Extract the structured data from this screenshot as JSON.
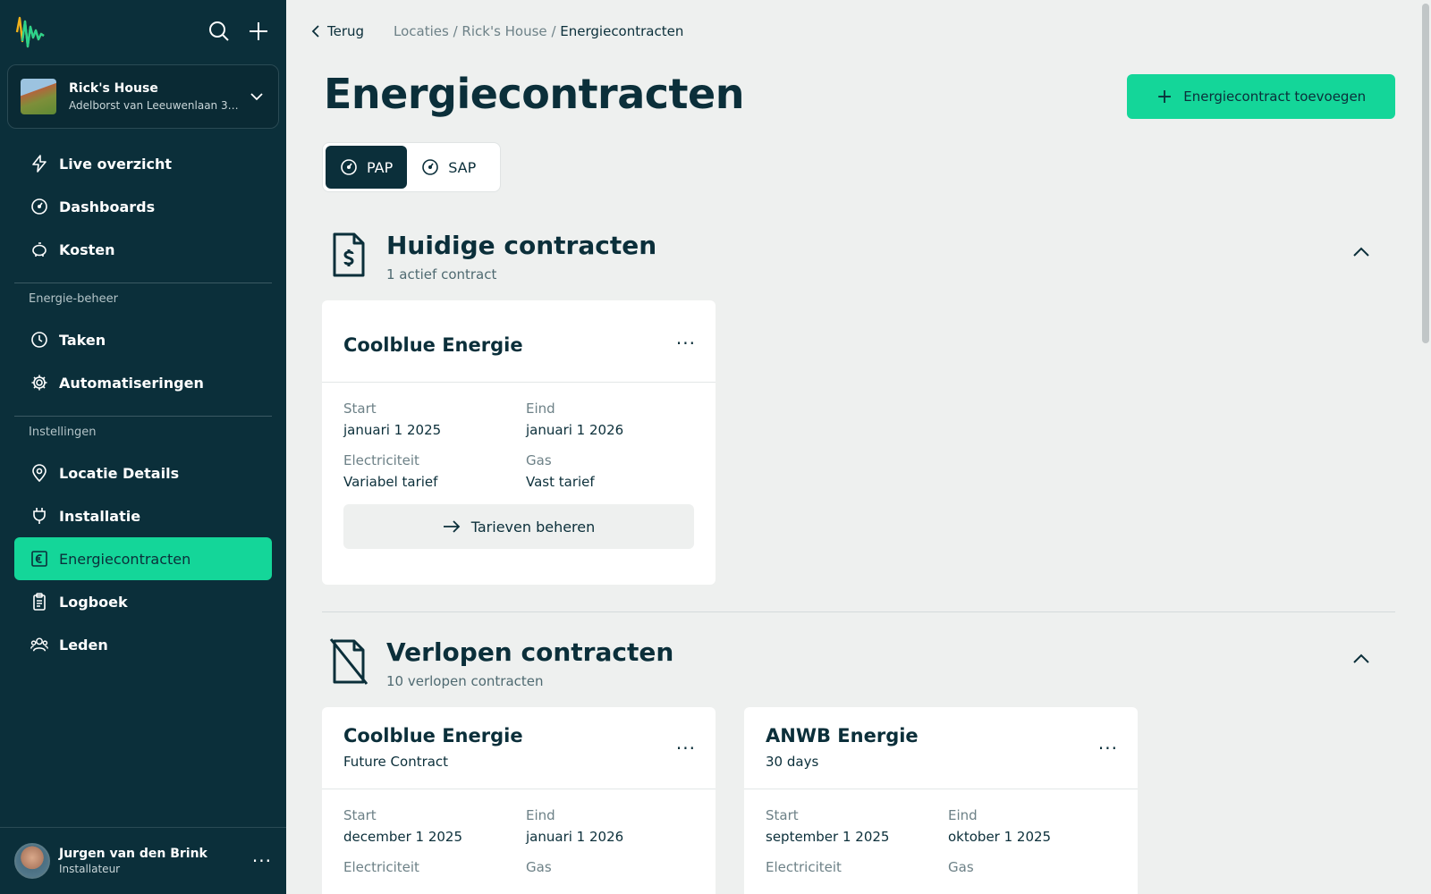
{
  "sidebar": {
    "location": {
      "name": "Rick's House",
      "address": "Adelborst van Leeuwenlaan 31,..."
    },
    "nav_main": [
      {
        "label": "Live overzicht",
        "icon": "bolt-icon"
      },
      {
        "label": "Dashboards",
        "icon": "gauge-icon"
      },
      {
        "label": "Kosten",
        "icon": "piggy-bank-icon"
      }
    ],
    "section_energy": "Energie-beheer",
    "nav_energy": [
      {
        "label": "Taken",
        "icon": "clock-icon"
      },
      {
        "label": "Automatiseringen",
        "icon": "gear-icon"
      }
    ],
    "section_settings": "Instellingen",
    "nav_settings": [
      {
        "label": "Locatie Details",
        "icon": "map-pin-icon"
      },
      {
        "label": "Installatie",
        "icon": "plug-icon"
      },
      {
        "label": "Energiecontracten",
        "icon": "euro-note-icon",
        "active": true
      },
      {
        "label": "Logboek",
        "icon": "clipboard-icon"
      },
      {
        "label": "Leden",
        "icon": "users-icon"
      }
    ],
    "user": {
      "name": "Jurgen van den Brink",
      "role": "Installateur",
      "more": "···"
    }
  },
  "header": {
    "back_label": "Terug",
    "breadcrumb": [
      "Locaties",
      "Rick's House",
      "Energiecontracten"
    ],
    "title": "Energiecontracten",
    "add_button": "Energiecontract toevoegen"
  },
  "tabs": [
    {
      "label": "PAP",
      "active": true
    },
    {
      "label": "SAP",
      "active": false
    }
  ],
  "current": {
    "title": "Huidige contracten",
    "subtitle": "1 actief contract",
    "cards": [
      {
        "provider": "Coolblue Energie",
        "more": "···",
        "start_label": "Start",
        "start": "januari 1 2025",
        "end_label": "Eind",
        "end": "januari 1 2026",
        "elec_label": "Electriciteit",
        "elec": "Variabel tarief",
        "gas_label": "Gas",
        "gas": "Vast tarief",
        "manage": "Tarieven beheren"
      }
    ]
  },
  "expired": {
    "title": "Verlopen contracten",
    "subtitle": "10 verlopen contracten",
    "cards": [
      {
        "provider": "Coolblue Energie",
        "tag": "Future Contract",
        "more": "···",
        "start_label": "Start",
        "start": "december 1 2025",
        "end_label": "Eind",
        "end": "januari 1 2026",
        "elec_label": "Electriciteit",
        "gas_label": "Gas"
      },
      {
        "provider": "ANWB Energie",
        "tag": "30 days",
        "more": "···",
        "start_label": "Start",
        "start": "september 1 2025",
        "end_label": "Eind",
        "end": "oktober 1 2025",
        "elec_label": "Electriciteit",
        "gas_label": "Gas"
      }
    ]
  },
  "colors": {
    "sidebar": "#0b2f3a",
    "accent": "#14d699",
    "background": "#eef0ef"
  }
}
